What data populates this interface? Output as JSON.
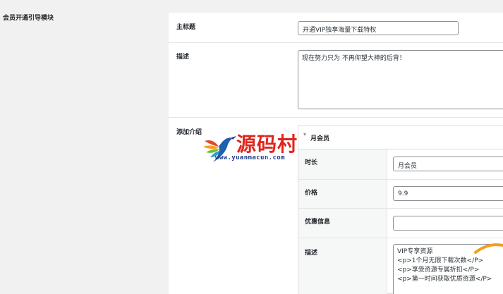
{
  "section": {
    "label": "会员开通引导模块"
  },
  "fields": {
    "main_title": {
      "label": "主标题",
      "value": "开通VIP独享海量下载特权"
    },
    "description": {
      "label": "描述",
      "value": "现在努力只为 不再仰望大神的后背！"
    },
    "add_intro": {
      "label": "添加介绍"
    }
  },
  "group": {
    "title": "月会员",
    "toggle_icon": "caret-down-icon",
    "duration": {
      "label": "时长",
      "value": "月会员"
    },
    "price": {
      "label": "价格",
      "value": "9.9"
    },
    "discount": {
      "label": "优惠信息",
      "value": ""
    },
    "desc": {
      "label": "描述",
      "lines": [
        "VIP专享资源",
        "<p>1个月无限下载次数</P>",
        "<p>享受资源专属折扣</P>",
        "<p>第一时间获取优质资源</P>"
      ]
    }
  },
  "watermark": {
    "text": "源码村",
    "url": "www.yuanmacun.com"
  }
}
